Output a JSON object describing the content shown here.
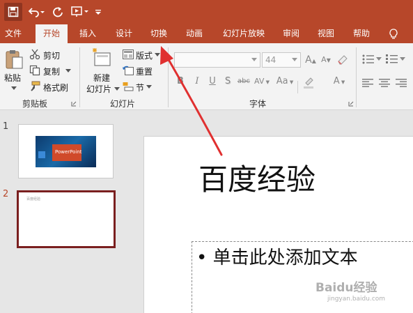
{
  "quick_access": {
    "save_icon": "save-icon",
    "undo_icon": "undo-icon",
    "redo_icon": "redo-icon",
    "present_icon": "present-from-start-icon",
    "customize_icon": "customize-qat-icon"
  },
  "tabs": [
    "文件",
    "开始",
    "插入",
    "设计",
    "切换",
    "动画",
    "幻灯片放映",
    "审阅",
    "视图",
    "帮助"
  ],
  "active_tab": "开始",
  "colors": {
    "accent": "#b7472a",
    "slide_selected_border": "#7a1f1f",
    "annotation_arrow": "#e03030"
  },
  "ribbon": {
    "clipboard": {
      "paste": "粘贴",
      "cut": "剪切",
      "copy": "复制",
      "format_painter": "格式刷",
      "label": "剪贴板"
    },
    "slides": {
      "new_slide_line1": "新建",
      "new_slide_line2": "幻灯片",
      "layout": "版式",
      "reset": "重置",
      "section": "节",
      "label": "幻灯片"
    },
    "font": {
      "font_size": "44",
      "bold": "B",
      "italic": "I",
      "underline": "U",
      "shadow": "S",
      "strikethrough": "abc",
      "spacing": "AV",
      "change_case": "Aa",
      "font_color": "A",
      "label": "字体"
    }
  },
  "thumbnails": [
    {
      "number": "1",
      "title": "PowerPoint"
    },
    {
      "number": "2",
      "title": "百度经验"
    }
  ],
  "slide": {
    "title": "百度经验",
    "body_placeholder": "单击此处添加文本"
  },
  "watermark": {
    "logo": "Baidu经验",
    "url": "jingyan.baidu.com"
  }
}
